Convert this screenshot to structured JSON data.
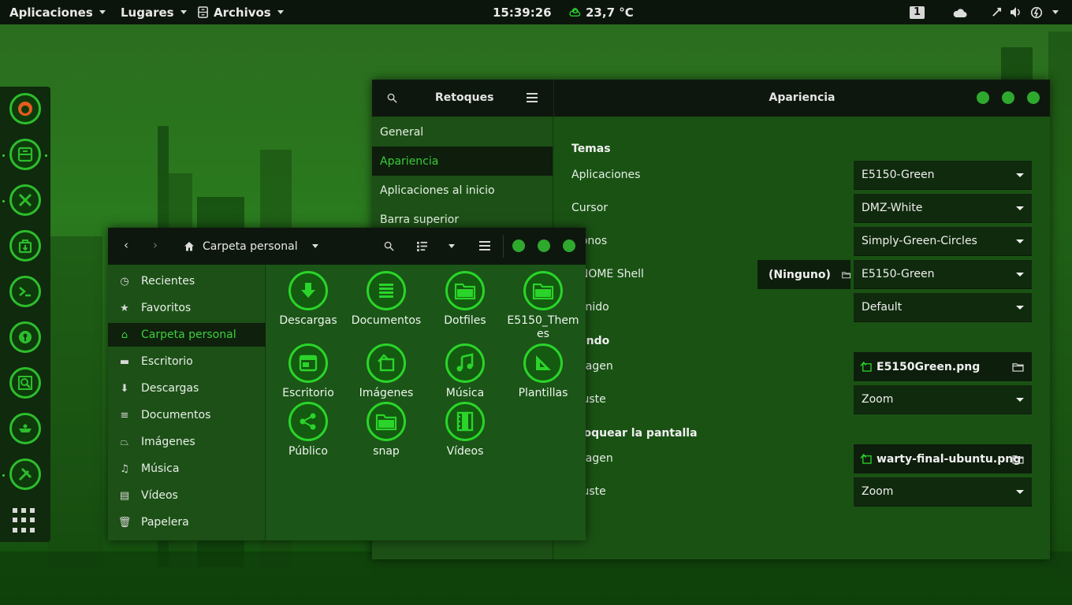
{
  "topbar": {
    "applications": "Aplicaciones",
    "places": "Lugares",
    "files_menu": "Archivos",
    "clock": "15:39:26",
    "weather": "23,7 °C",
    "workspace": "1"
  },
  "dock": {
    "items": [
      "firefox-icon",
      "files-cabinet-icon",
      "tools-icon",
      "software-bag-icon",
      "terminal-icon",
      "passwords-keyhole-icon",
      "search-magnifier-icon",
      "lamp-icon",
      "hammer-wrench-icon"
    ],
    "show_apps": "apps-grid-icon"
  },
  "tweaks": {
    "title": "Retoques",
    "section_title": "Apariencia",
    "sidebar": [
      "General",
      "Apariencia",
      "Aplicaciones al inicio",
      "Barra superior"
    ],
    "themes_header": "Temas",
    "themes": [
      {
        "label": "Aplicaciones",
        "value": "E5150-Green"
      },
      {
        "label": "Cursor",
        "value": "DMZ-White"
      },
      {
        "label": "Iconos",
        "value": "Simply-Green-Circles"
      },
      {
        "label": "GNOME Shell",
        "value": "E5150-Green",
        "extra": "(Ninguno)"
      },
      {
        "label": "Sonido",
        "value": "Default"
      }
    ],
    "background_header": "Fondo",
    "background": [
      {
        "label": "Imagen",
        "value": "E5150Green.png"
      },
      {
        "label": "Ajuste",
        "value": "Zoom"
      }
    ],
    "lock_header": "Bloquear la pantalla",
    "lock": [
      {
        "label": "Imagen",
        "value": "warty-final-ubuntu.png"
      },
      {
        "label": "Ajuste",
        "value": "Zoom"
      }
    ]
  },
  "files": {
    "location": "Carpeta personal",
    "sidebar": [
      {
        "label": "Recientes",
        "icon": "clock-icon"
      },
      {
        "label": "Favoritos",
        "icon": "star-icon"
      },
      {
        "label": "Carpeta personal",
        "icon": "home-icon"
      },
      {
        "label": "Escritorio",
        "icon": "desktop-icon"
      },
      {
        "label": "Descargas",
        "icon": "download-icon"
      },
      {
        "label": "Documentos",
        "icon": "document-icon"
      },
      {
        "label": "Imágenes",
        "icon": "image-icon"
      },
      {
        "label": "Música",
        "icon": "music-icon"
      },
      {
        "label": "Vídeos",
        "icon": "video-icon"
      },
      {
        "label": "Papelera",
        "icon": "trash-icon"
      }
    ],
    "items": [
      {
        "label": "Descargas",
        "icon": "download-folder-icon"
      },
      {
        "label": "Documentos",
        "icon": "documents-folder-icon"
      },
      {
        "label": "Dotfiles",
        "icon": "folder-icon"
      },
      {
        "label": "E5150_Themes",
        "icon": "folder-icon"
      },
      {
        "label": "Escritorio",
        "icon": "desktop-folder-icon"
      },
      {
        "label": "Imágenes",
        "icon": "images-folder-icon"
      },
      {
        "label": "Música",
        "icon": "music-folder-icon"
      },
      {
        "label": "Plantillas",
        "icon": "templates-folder-icon"
      },
      {
        "label": "Público",
        "icon": "public-folder-icon"
      },
      {
        "label": "snap",
        "icon": "folder-icon"
      },
      {
        "label": "Vídeos",
        "icon": "videos-folder-icon"
      }
    ]
  },
  "colors": {
    "accent": "#2ad42a",
    "panel": "#0e170e",
    "window": "#1b5316"
  }
}
